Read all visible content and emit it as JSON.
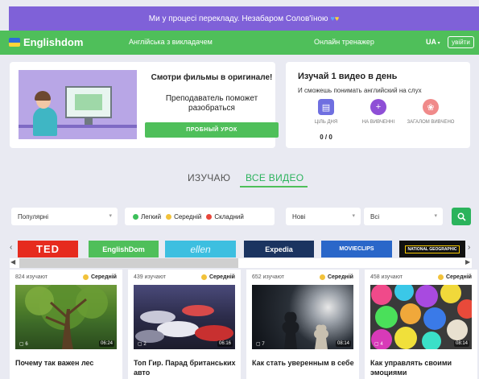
{
  "banner": {
    "text": "Ми у процесі перекладу. Незабаром Солов'їною"
  },
  "nav": {
    "logo": "Englishdom",
    "link1": "Англійська з викладачем",
    "link2": "Онлайн тренажер",
    "lang": "UA",
    "login": "увійти"
  },
  "promo": {
    "title": "Смотри фильмы в оригинале!",
    "subtitle": "Преподаватель поможет разобраться",
    "button": "ПРОБНЫЙ УРОК"
  },
  "daily": {
    "title": "Изучай 1 видео в день",
    "subtitle": "И сможешь понимать английский на слух",
    "stats": [
      {
        "label": "ЦІЛЬ ДНЯ",
        "icon": "target-icon",
        "color": "#6f6fe0"
      },
      {
        "label": "НА ВИВЧЕННІ",
        "icon": "plus-icon",
        "color": "#8e4fd6"
      },
      {
        "label": "ЗАГАЛОМ ВИВЧЕНО",
        "icon": "brain-icon",
        "color": "#f08a8a"
      }
    ],
    "score": "0 / 0"
  },
  "tabs": {
    "learning": "ИЗУЧАЮ",
    "all": "ВСЕ ВИДЕО"
  },
  "filters": {
    "sort": "Популярні",
    "levels": [
      {
        "label": "Легкий",
        "color": "#3cbf5a"
      },
      {
        "label": "Середній",
        "color": "#f2c23a"
      },
      {
        "label": "Складний",
        "color": "#e8463a"
      }
    ],
    "period": "Нові",
    "category": "Всі"
  },
  "brands": [
    {
      "label": "TED",
      "bg": "#e62b1e"
    },
    {
      "label": "EnglishDom",
      "bg": "#4fbf5a"
    },
    {
      "label": "ellen",
      "bg": "#3dbfe0"
    },
    {
      "label": "Expedia",
      "bg": "#1b3460"
    },
    {
      "label": "MOVIECLIPS",
      "bg": "#2a67c9"
    },
    {
      "label": "NATIONAL GEOGRAPHIC",
      "bg": "#111111"
    }
  ],
  "videos": [
    {
      "learners": "824 изучают",
      "level": "Середній",
      "count": "6",
      "duration": "06:24",
      "title": "Почему так важен лес"
    },
    {
      "learners": "439 изучают",
      "level": "Середній",
      "count": "2",
      "duration": "06:16",
      "title": "Топ Гир. Парад британських авто"
    },
    {
      "learners": "652 изучают",
      "level": "Середній",
      "count": "7",
      "duration": "08:14",
      "title": "Как стать уверенным в себе"
    },
    {
      "learners": "458 изучают",
      "level": "Середній",
      "count": "4",
      "duration": "08:14",
      "title": "Как управлять своими эмоциями"
    }
  ]
}
